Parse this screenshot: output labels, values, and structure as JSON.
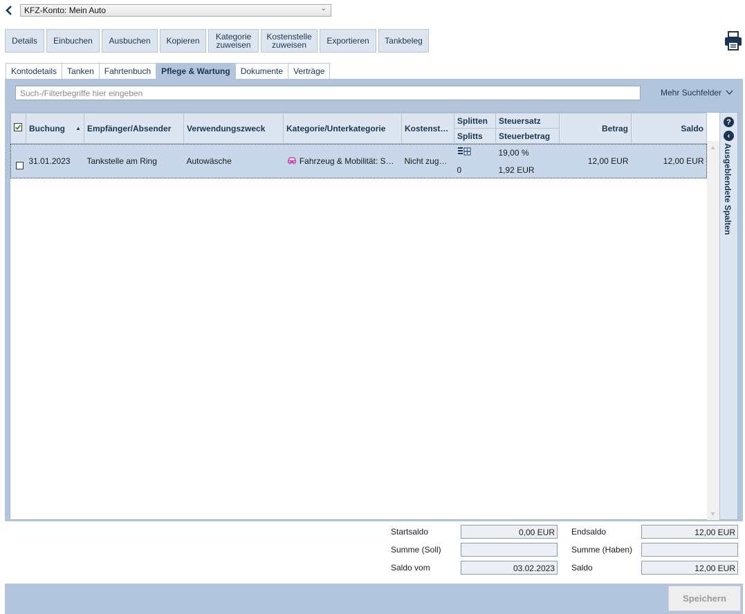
{
  "account": {
    "selected": "KFZ-Konto: Mein Auto"
  },
  "toolbar": {
    "details": "Details",
    "einbuchen": "Einbuchen",
    "ausbuchen": "Ausbuchen",
    "kopieren": "Kopieren",
    "kategorie_line1": "Kategorie",
    "kategorie_line2": "zuweisen",
    "kostenstelle_line1": "Kostenstelle",
    "kostenstelle_line2": "zuweisen",
    "exportieren": "Exportieren",
    "tankbeleg": "Tankbeleg"
  },
  "tabs": [
    {
      "label": "Kontodetails"
    },
    {
      "label": "Tanken"
    },
    {
      "label": "Fahrtenbuch"
    },
    {
      "label": "Pflege & Wartung",
      "active": true
    },
    {
      "label": "Dokumente"
    },
    {
      "label": "Verträge"
    }
  ],
  "search": {
    "placeholder": "Such-/Filterbegriffe hier eingeben",
    "more": "Mehr Suchfelder"
  },
  "columns": {
    "buchung": "Buchung",
    "empfaenger": "Empfänger/Absender",
    "verwendung": "Verwendungszweck",
    "kategorie": "Kategorie/Unterkategorie",
    "kostenstelle": "Kostenst…",
    "splitten": "Splitten",
    "splitts": "Splitts",
    "steuersatz": "Steuersatz",
    "steuerbetrag": "Steuerbetrag",
    "betrag": "Betrag",
    "saldo": "Saldo"
  },
  "rows": [
    {
      "buchung": "31.01.2023",
      "empfaenger": "Tankstelle am Ring",
      "verwendung": "Autowäsche",
      "kategorie": "Fahrzeug & Mobilität: S…",
      "kostenstelle": "Nicht zug…",
      "splitts": "0",
      "steuersatz": "19,00 %",
      "steuerbetrag": "1,92 EUR",
      "betrag": "12,00 EUR",
      "saldo": "12,00 EUR"
    }
  ],
  "hidden_columns_label": "Ausgeblendete Spalten",
  "summary": {
    "startsaldo_label": "Startsaldo",
    "startsaldo_value": "0,00 EUR",
    "summe_soll_label": "Summe (Soll)",
    "summe_soll_value": "",
    "saldo_vom_label": "Saldo vom",
    "saldo_vom_value": "03.02.2023",
    "endsaldo_label": "Endsaldo",
    "endsaldo_value": "12,00 EUR",
    "summe_haben_label": "Summe (Haben)",
    "summe_haben_value": "",
    "saldo_label": "Saldo",
    "saldo_value": "12,00 EUR"
  },
  "save_label": "Speichern",
  "colors": {
    "accent": "#1b3550",
    "panel": "#b3c5dc",
    "category_icon": "#c24bb5"
  }
}
